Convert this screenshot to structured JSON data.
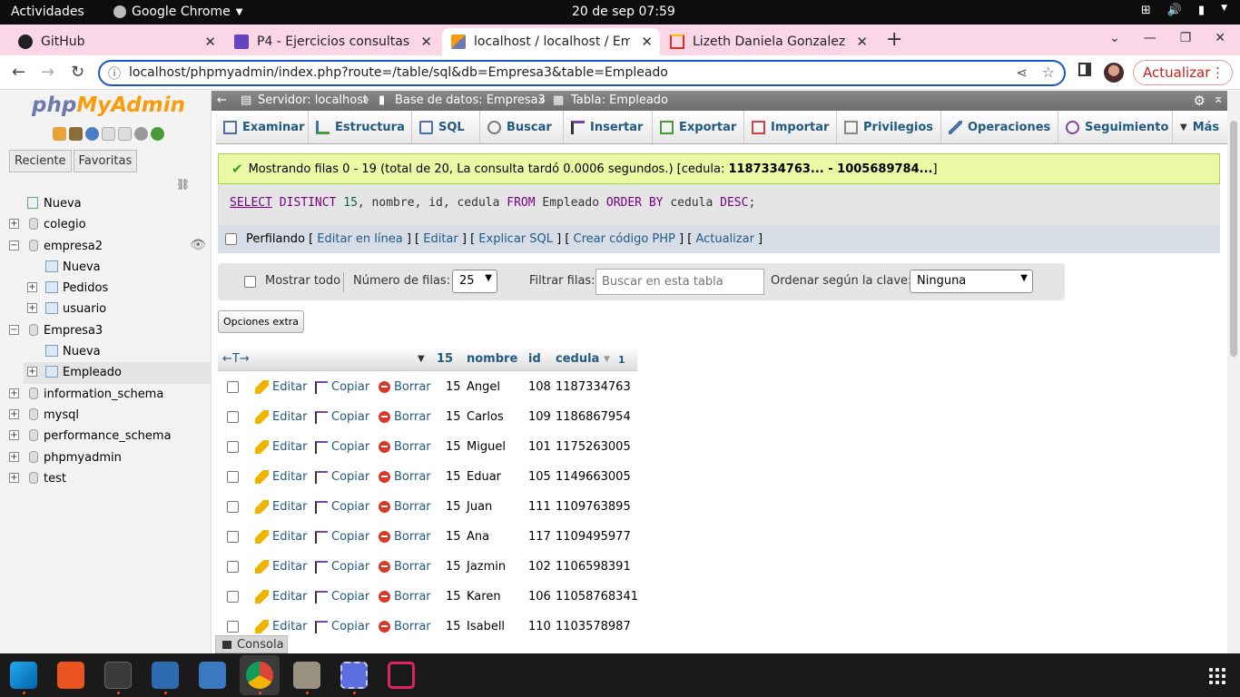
{
  "os": {
    "activities": "Actividades",
    "app_name": "Google Chrome",
    "clock": "20 de sep  07:59"
  },
  "tabs": [
    {
      "title": "GitHub",
      "favicon": "github-icon"
    },
    {
      "title": "P4 - Ejercicios consultas 2",
      "favicon": "document-icon"
    },
    {
      "title": "localhost / localhost / Emp",
      "favicon": "phpmyadmin-icon"
    },
    {
      "title": "Lizeth Daniela Gonzalez G",
      "favicon": "gmail-icon"
    }
  ],
  "browser": {
    "url": "localhost/phpmyadmin/index.php?route=/table/sql&db=Empresa3&table=Empleado",
    "update_label": "Actualizar"
  },
  "sidebar": {
    "logo_php": "php",
    "logo_my": "MyAdmin",
    "recent_tab": "Reciente",
    "favorites_tab": "Favoritas",
    "tree": [
      {
        "label": "Nueva",
        "kind": "new",
        "level": 0
      },
      {
        "label": "colegio",
        "kind": "db",
        "level": 0
      },
      {
        "label": "empresa2",
        "kind": "db-open",
        "level": 0
      },
      {
        "label": "Nueva",
        "kind": "new",
        "level": 1
      },
      {
        "label": "Pedidos",
        "kind": "table",
        "level": 1
      },
      {
        "label": "usuario",
        "kind": "table",
        "level": 1
      },
      {
        "label": "Empresa3",
        "kind": "db-open",
        "level": 0
      },
      {
        "label": "Nueva",
        "kind": "new",
        "level": 1
      },
      {
        "label": "Empleado",
        "kind": "table",
        "level": 1
      },
      {
        "label": "information_schema",
        "kind": "db",
        "level": 0
      },
      {
        "label": "mysql",
        "kind": "db",
        "level": 0
      },
      {
        "label": "performance_schema",
        "kind": "db",
        "level": 0
      },
      {
        "label": "phpmyadmin",
        "kind": "db",
        "level": 0
      },
      {
        "label": "test",
        "kind": "db",
        "level": 0
      }
    ]
  },
  "breadcrumb": {
    "server": "Servidor: localhost",
    "database": "Base de datos: Empresa3",
    "table": "Tabla: Empleado"
  },
  "menu": [
    "Examinar",
    "Estructura",
    "SQL",
    "Buscar",
    "Insertar",
    "Exportar",
    "Importar",
    "Privilegios",
    "Operaciones",
    "Seguimiento",
    "Más"
  ],
  "result": {
    "message": "Mostrando filas 0 - 19 (total de 20, La consulta tardó 0.0006 segundos.) [cedula: ",
    "message_bold": "1187334763... - 1005689784...",
    "message_end": "]"
  },
  "sql": {
    "select": "SELECT",
    "distinct": "DISTINCT",
    "num": "15",
    "fields": ", nombre, id, cedula",
    "from": "FROM",
    "table": "Empleado",
    "order": "ORDER BY",
    "col": "cedula",
    "desc": "DESC",
    "end": ";"
  },
  "profiling": {
    "label": "Perfilando",
    "links": [
      "Editar en línea",
      "Editar",
      "Explicar SQL",
      "Crear código PHP",
      "Actualizar"
    ]
  },
  "controls": {
    "show_all": "Mostrar todo",
    "rows_label": "Número de filas:",
    "rows_value": "25",
    "filter_label": "Filtrar filas:",
    "filter_placeholder": "Buscar en esta tabla",
    "sort_label": "Ordenar según la clave:",
    "sort_value": "Ninguna",
    "extra_options": "Opciones extra"
  },
  "table": {
    "headers": {
      "c15": "15",
      "nombre": "nombre",
      "id": "id",
      "cedula": "cedula",
      "sort_order": "1"
    },
    "actions": {
      "edit": "Editar",
      "copy": "Copiar",
      "delete": "Borrar"
    },
    "rows": [
      {
        "c15": "15",
        "nombre": "Angel",
        "id": "108",
        "cedula": "1187334763"
      },
      {
        "c15": "15",
        "nombre": "Carlos",
        "id": "109",
        "cedula": "1186867954"
      },
      {
        "c15": "15",
        "nombre": "Miguel",
        "id": "101",
        "cedula": "1175263005"
      },
      {
        "c15": "15",
        "nombre": "Eduar",
        "id": "105",
        "cedula": "1149663005"
      },
      {
        "c15": "15",
        "nombre": "Juan",
        "id": "111",
        "cedula": "1109763895"
      },
      {
        "c15": "15",
        "nombre": "Ana",
        "id": "117",
        "cedula": "1109495977"
      },
      {
        "c15": "15",
        "nombre": "Jazmin",
        "id": "102",
        "cedula": "1106598391"
      },
      {
        "c15": "15",
        "nombre": "Karen",
        "id": "106",
        "cedula": "11058768341"
      },
      {
        "c15": "15",
        "nombre": "Isabell",
        "id": "110",
        "cedula": "1103578987"
      }
    ]
  },
  "console_label": "Consola",
  "taskbar": [
    "vscode-icon",
    "software-icon",
    "terminal-icon",
    "text-editor-icon",
    "system-monitor-icon",
    "chrome-icon",
    "files-icon",
    "screenshot-icon",
    "snap-icon"
  ]
}
